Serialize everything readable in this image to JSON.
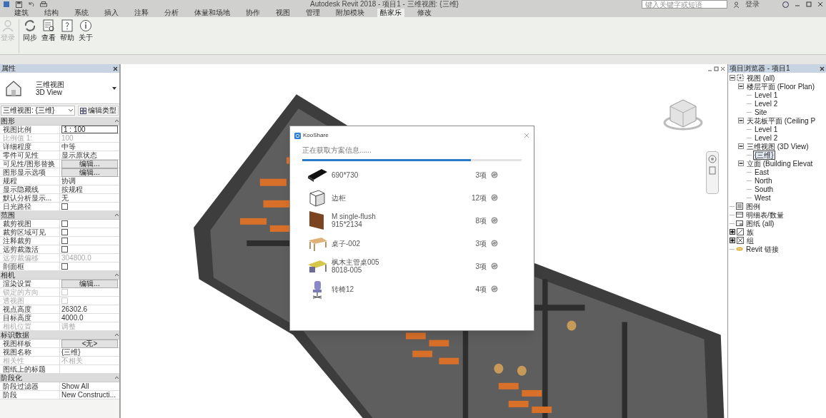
{
  "window": {
    "title": "Autodesk Revit 2018 -   项目1 - 三维视图: {三维}",
    "search_placeholder": "键入关键字或短语",
    "sign_in": "登录"
  },
  "ribbon_tabs": [
    {
      "label": "建筑",
      "selected": false
    },
    {
      "label": "结构",
      "selected": false
    },
    {
      "label": "系统",
      "selected": false
    },
    {
      "label": "插入",
      "selected": false
    },
    {
      "label": "注释",
      "selected": false
    },
    {
      "label": "分析",
      "selected": false
    },
    {
      "label": "体量和场地",
      "selected": false
    },
    {
      "label": "协作",
      "selected": false
    },
    {
      "label": "视图",
      "selected": false
    },
    {
      "label": "管理",
      "selected": false
    },
    {
      "label": "附加模块",
      "selected": false
    },
    {
      "label": "酷家乐",
      "selected": true
    },
    {
      "label": "修改",
      "selected": false
    }
  ],
  "ribbon_buttons": [
    {
      "kind": "user",
      "label": "登录",
      "disabled": true
    },
    {
      "kind": "sync",
      "label": "同步",
      "disabled": false
    },
    {
      "kind": "view",
      "label": "查看",
      "disabled": false
    },
    {
      "kind": "help",
      "label": "帮助",
      "disabled": false
    },
    {
      "kind": "info",
      "label": "关于",
      "disabled": false
    }
  ],
  "properties": {
    "title": "属性",
    "type_name": "三维视图",
    "type_name_en": "3D View",
    "type_selector": "三维视图: {三维}",
    "edit_type": "编辑类型",
    "rows": [
      {
        "kind": "section",
        "label": "图形"
      },
      {
        "kind": "field",
        "label": "视图比例",
        "value": "1 : 100",
        "disabled": false
      },
      {
        "kind": "text",
        "label": "比例值 1:",
        "value": "100",
        "disabled": true
      },
      {
        "kind": "text",
        "label": "详细程度",
        "value": "中等",
        "disabled": false
      },
      {
        "kind": "text",
        "label": "零件可见性",
        "value": "显示原状态",
        "disabled": false
      },
      {
        "kind": "button",
        "label": "可见性/图形替换",
        "value": "编辑...",
        "disabled": false
      },
      {
        "kind": "button",
        "label": "图形显示选项",
        "value": "编辑...",
        "disabled": false
      },
      {
        "kind": "text",
        "label": "规程",
        "value": "协调",
        "disabled": false
      },
      {
        "kind": "text",
        "label": "显示隐藏线",
        "value": "按规程",
        "disabled": false
      },
      {
        "kind": "text",
        "label": "默认分析显示...",
        "value": "无",
        "disabled": false
      },
      {
        "kind": "checkbox",
        "label": "日光路径",
        "checked": false,
        "disabled": false
      },
      {
        "kind": "section",
        "label": "范围"
      },
      {
        "kind": "checkbox",
        "label": "裁剪视图",
        "checked": false,
        "disabled": false
      },
      {
        "kind": "checkbox",
        "label": "裁剪区域可见",
        "checked": false,
        "disabled": false
      },
      {
        "kind": "checkbox",
        "label": "注释裁剪",
        "checked": false,
        "disabled": false
      },
      {
        "kind": "checkbox",
        "label": "远剪裁激活",
        "checked": false,
        "disabled": false
      },
      {
        "kind": "text",
        "label": "远剪裁偏移",
        "value": "304800.0",
        "disabled": true
      },
      {
        "kind": "checkbox",
        "label": "剖面框",
        "checked": false,
        "disabled": false
      },
      {
        "kind": "section",
        "label": "相机"
      },
      {
        "kind": "button",
        "label": "渲染设置",
        "value": "编辑...",
        "disabled": false
      },
      {
        "kind": "checkbox",
        "label": "锁定的方向",
        "checked": false,
        "disabled": true
      },
      {
        "kind": "checkbox",
        "label": "透视图",
        "checked": false,
        "disabled": true
      },
      {
        "kind": "text",
        "label": "视点高度",
        "value": "26302.6",
        "disabled": false
      },
      {
        "kind": "text",
        "label": "目标高度",
        "value": "4000.0",
        "disabled": false
      },
      {
        "kind": "text",
        "label": "相机位置",
        "value": "调整",
        "disabled": true
      },
      {
        "kind": "section",
        "label": "标识数据"
      },
      {
        "kind": "button",
        "label": "视图样板",
        "value": "<无>",
        "disabled": false
      },
      {
        "kind": "text",
        "label": "视图名称",
        "value": "{三维}",
        "disabled": false
      },
      {
        "kind": "text",
        "label": "相关性",
        "value": "不相关",
        "disabled": true
      },
      {
        "kind": "text",
        "label": "图纸上的标题",
        "disabled": false
      },
      {
        "kind": "section",
        "label": "阶段化"
      },
      {
        "kind": "text",
        "label": "阶段过滤器",
        "value": "Show All",
        "disabled": false
      },
      {
        "kind": "text",
        "label": "阶段",
        "value": "New Constructi...",
        "disabled": false
      }
    ]
  },
  "dialog": {
    "title": "KooShare",
    "status": "正在获取方案信息......",
    "progress": {
      "level": 0.77
    },
    "items": [
      {
        "kind": "sofa",
        "sub": "690*730",
        "count": "3项"
      },
      {
        "kind": "cabinet",
        "name": "边柜",
        "count": "12项"
      },
      {
        "kind": "door",
        "name": "M single-flush",
        "sub": "915*2134",
        "count": "8项"
      },
      {
        "kind": "table",
        "name": "桌子-002",
        "count": "3项"
      },
      {
        "kind": "desk",
        "name": "枫木主管桌005",
        "sub": "8018-005",
        "count": "3项"
      },
      {
        "kind": "chair",
        "name": "转椅12",
        "count": "4项"
      }
    ]
  },
  "project_browser": {
    "title": "项目浏览器 - 项目1",
    "tree": [
      {
        "label": "视图 (all)",
        "kind": "views",
        "expanded": true,
        "selected": false,
        "children": [
          {
            "label": "楼层平面 (Floor Plan)",
            "expanded": true,
            "selected": false,
            "children": [
              {
                "label": "Level 1",
                "selected": false
              },
              {
                "label": "Level 2",
                "selected": false
              },
              {
                "label": "Site",
                "selected": false
              }
            ]
          },
          {
            "label": "天花板平面 (Ceiling P",
            "expanded": true,
            "selected": false,
            "children": [
              {
                "label": "Level 1",
                "selected": false
              },
              {
                "label": "Level 2",
                "selected": false
              }
            ]
          },
          {
            "label": "三维视图 (3D View)",
            "expanded": true,
            "selected": false,
            "children": [
              {
                "label": "{三维}",
                "selected": true
              }
            ]
          },
          {
            "label": "立面 (Building Elevat",
            "expanded": true,
            "selected": false,
            "children": [
              {
                "label": "East",
                "selected": false
              },
              {
                "label": "North",
                "selected": false
              },
              {
                "label": "South",
                "selected": false
              },
              {
                "label": "West",
                "selected": false
              }
            ]
          }
        ]
      },
      {
        "label": "图例",
        "kind": "legend",
        "selected": false
      },
      {
        "label": "明细表/数量",
        "kind": "schedule",
        "selected": false
      },
      {
        "label": "图纸 (all)",
        "kind": "sheet",
        "selected": false
      },
      {
        "label": "族",
        "kind": "family",
        "expanded": false,
        "selected": false
      },
      {
        "label": "组",
        "kind": "group",
        "expanded": false,
        "selected": false
      },
      {
        "label": "Revit 链接",
        "kind": "link",
        "selected": false
      }
    ]
  }
}
